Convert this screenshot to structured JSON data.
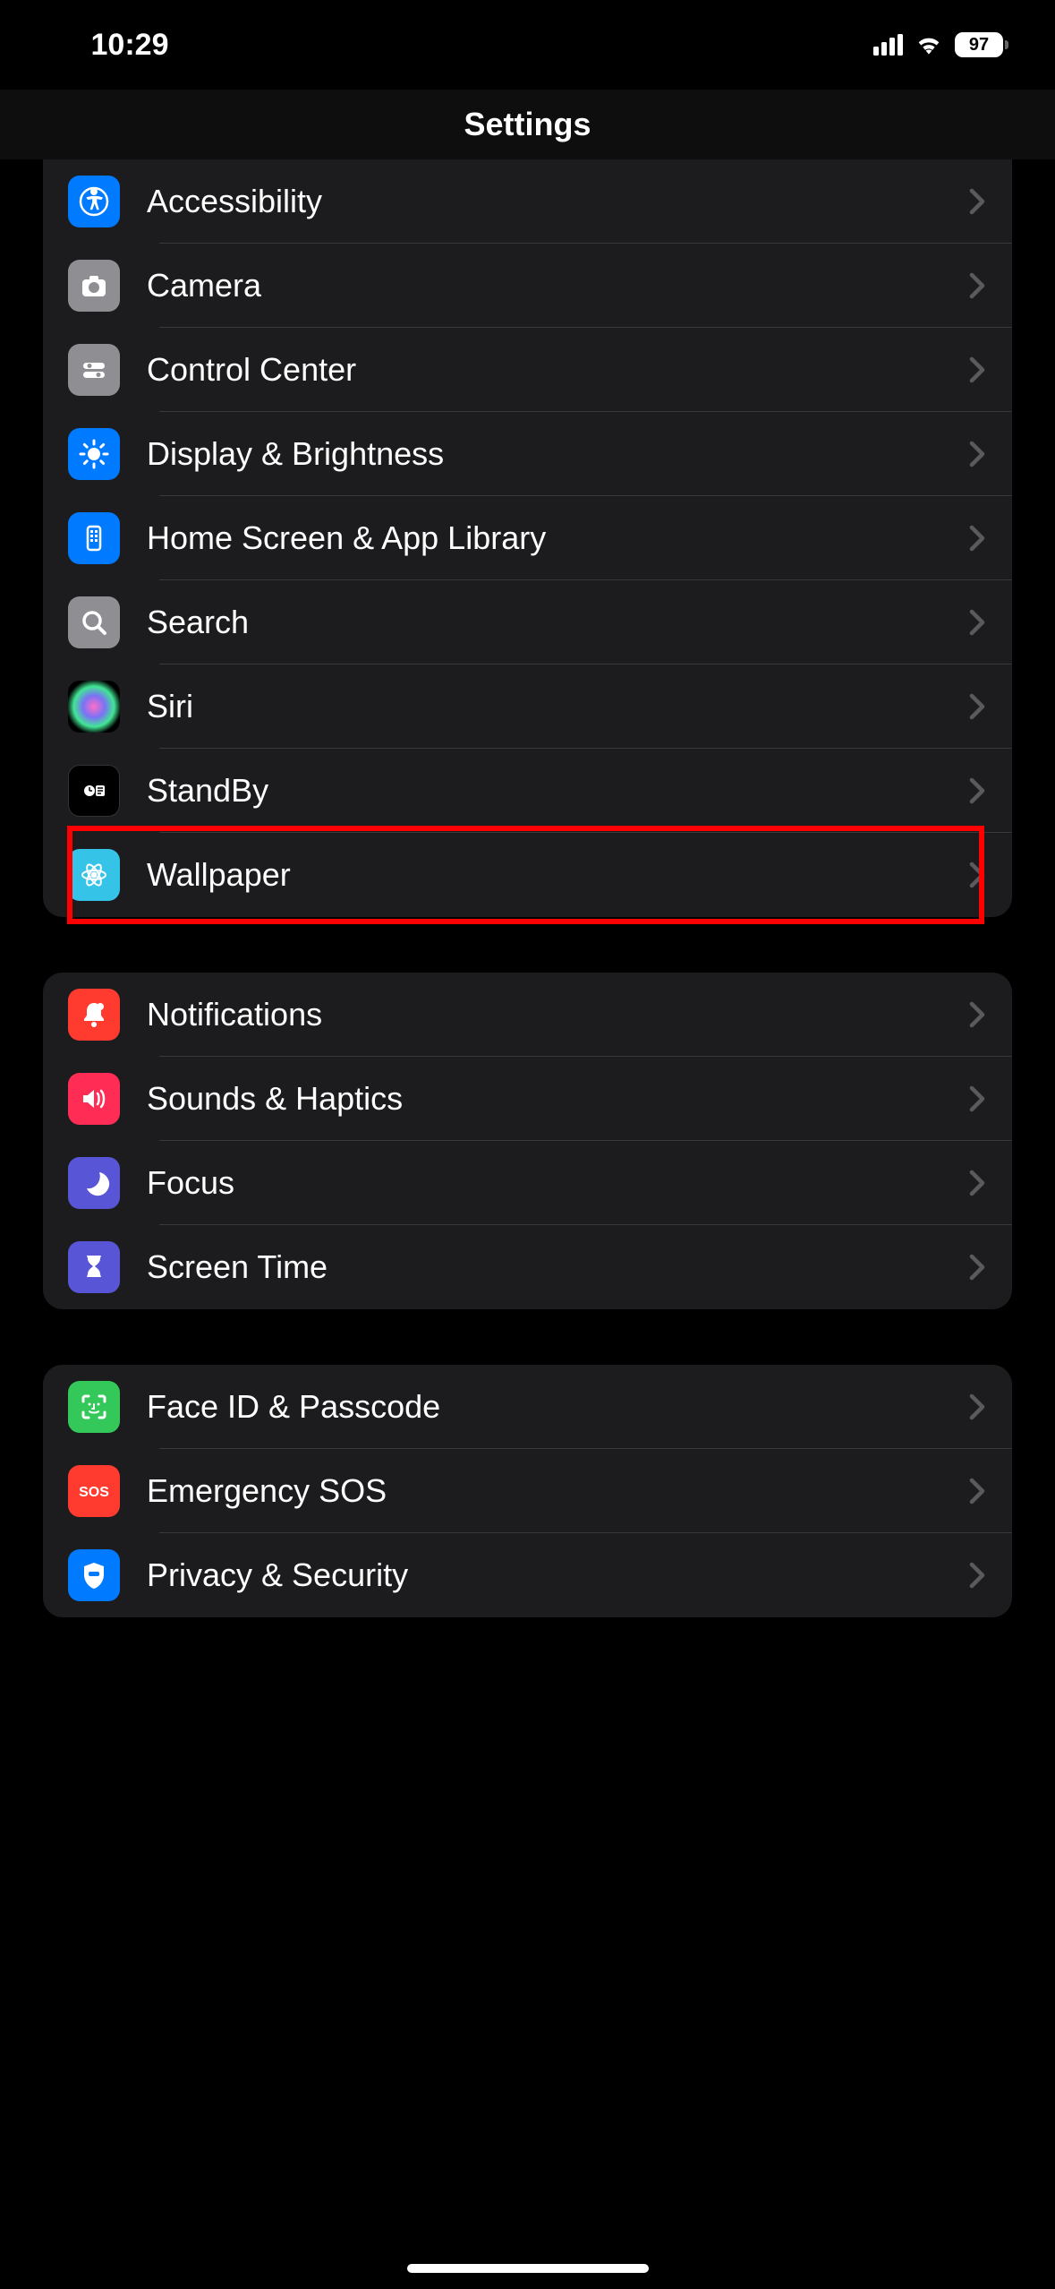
{
  "status": {
    "time": "10:29",
    "battery": "97"
  },
  "header": {
    "title": "Settings"
  },
  "groups": [
    {
      "items": [
        {
          "label": "Accessibility",
          "icon": "accessibility",
          "color": "ic-blue",
          "name": "settings-row-accessibility"
        },
        {
          "label": "Camera",
          "icon": "camera",
          "color": "ic-gray",
          "name": "settings-row-camera"
        },
        {
          "label": "Control Center",
          "icon": "control-center",
          "color": "ic-gray",
          "name": "settings-row-control-center"
        },
        {
          "label": "Display & Brightness",
          "icon": "brightness",
          "color": "ic-blue",
          "name": "settings-row-display-brightness"
        },
        {
          "label": "Home Screen & App Library",
          "icon": "home-screen",
          "color": "ic-blue",
          "name": "settings-row-home-screen"
        },
        {
          "label": "Search",
          "icon": "search",
          "color": "ic-gray",
          "name": "settings-row-search"
        },
        {
          "label": "Siri",
          "icon": "siri",
          "color": "ic-siri",
          "name": "settings-row-siri"
        },
        {
          "label": "StandBy",
          "icon": "standby",
          "color": "ic-black",
          "name": "settings-row-standby"
        },
        {
          "label": "Wallpaper",
          "icon": "wallpaper",
          "color": "ic-cyan",
          "name": "settings-row-wallpaper",
          "highlighted": true
        }
      ]
    },
    {
      "items": [
        {
          "label": "Notifications",
          "icon": "notifications",
          "color": "ic-red",
          "name": "settings-row-notifications"
        },
        {
          "label": "Sounds & Haptics",
          "icon": "sounds",
          "color": "ic-pink",
          "name": "settings-row-sounds"
        },
        {
          "label": "Focus",
          "icon": "focus",
          "color": "ic-indigo",
          "name": "settings-row-focus"
        },
        {
          "label": "Screen Time",
          "icon": "screen-time",
          "color": "ic-indigo",
          "name": "settings-row-screen-time"
        }
      ]
    },
    {
      "items": [
        {
          "label": "Face ID & Passcode",
          "icon": "face-id",
          "color": "ic-green",
          "name": "settings-row-face-id"
        },
        {
          "label": "Emergency SOS",
          "icon": "sos",
          "color": "ic-red",
          "name": "settings-row-emergency-sos"
        },
        {
          "label": "Privacy & Security",
          "icon": "privacy",
          "color": "ic-blue",
          "name": "settings-row-privacy"
        }
      ]
    }
  ]
}
